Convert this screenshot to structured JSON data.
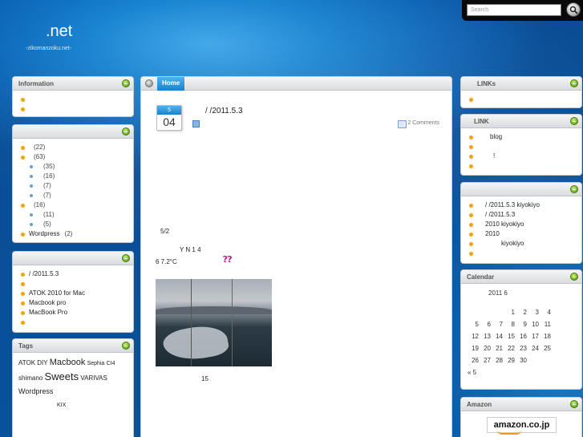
{
  "site": {
    "title": ".net",
    "tagline": "-zikomanzoku.net-"
  },
  "search": {
    "placeholder": "Search"
  },
  "left_sidebar": {
    "information": {
      "title": "Information",
      "items": [
        "",
        ""
      ]
    },
    "categories": {
      "title": "",
      "items": [
        {
          "label": "",
          "count": "(22)",
          "sub": false
        },
        {
          "label": "",
          "count": "(63)",
          "sub": false
        },
        {
          "label": "",
          "count": "(35)",
          "sub": true
        },
        {
          "label": "",
          "count": "(16)",
          "sub": true
        },
        {
          "label": "",
          "count": "(7)",
          "sub": true
        },
        {
          "label": "",
          "count": "(7)",
          "sub": true
        },
        {
          "label": "",
          "count": "(16)",
          "sub": false
        },
        {
          "label": "",
          "count": "(11)",
          "sub": true
        },
        {
          "label": "",
          "count": "(5)",
          "sub": true
        },
        {
          "label": "Wordpress",
          "count": "(2)",
          "sub": false
        }
      ]
    },
    "recent_posts": {
      "title": "",
      "items": [
        "/ /2011.5.3",
        "",
        "ATOK 2010 for Mac",
        "Macbook pro",
        "MacBook Pro",
        ""
      ]
    },
    "tags": {
      "title": "Tags",
      "line1": [
        "ATOK",
        "DIY",
        "Macbook",
        "Sephia",
        "CI4"
      ],
      "line2": [
        "shimano",
        "Sweets",
        "VARIVAS"
      ],
      "line3": [
        "Wordpress"
      ],
      "line4": [
        "KIX"
      ]
    }
  },
  "main": {
    "tab_home": "Home",
    "post": {
      "month": "5",
      "day": "04",
      "title": "/ /2011.5.3",
      "comments": "2 Comments",
      "lines": [
        "5/2",
        "Y       N                1    4",
        "6                    7.2°C",
        "15"
      ]
    }
  },
  "right_sidebar": {
    "links": {
      "title": "LINKs",
      "items": [
        ""
      ]
    },
    "link": {
      "title": "LINK",
      "items": [
        "blog",
        "",
        "!",
        ""
      ]
    },
    "comments": {
      "title": "",
      "items": [
        "/ /2011.5.3  kiyokiyo",
        "/ /2011.5.3",
        "2010  kiyokiyo",
        "2010",
        "kiyokiyo",
        ""
      ]
    },
    "calendar": {
      "title": "Calendar",
      "caption": "2011 6",
      "rows": [
        [
          "",
          "",
          "1",
          "2",
          "3",
          "4"
        ],
        [
          "5",
          "6",
          "7",
          "8",
          "9",
          "10",
          "11"
        ],
        [
          "12",
          "13",
          "14",
          "15",
          "16",
          "17",
          "18"
        ],
        [
          "19",
          "20",
          "21",
          "22",
          "23",
          "24",
          "25"
        ],
        [
          "26",
          "27",
          "28",
          "29",
          "30"
        ]
      ],
      "prev": "« 5"
    },
    "amazon": {
      "title": "Amazon",
      "logo_text": "amazon.co.jp"
    }
  }
}
